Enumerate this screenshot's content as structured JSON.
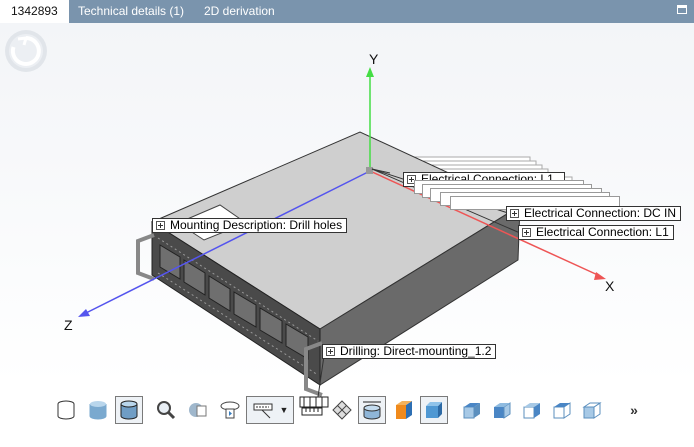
{
  "tabs": [
    {
      "label": "1342893",
      "active": true
    },
    {
      "label": "Technical details (1)",
      "active": false
    },
    {
      "label": "2D derivation",
      "active": false
    }
  ],
  "axes": {
    "x": "X",
    "y": "Y",
    "z": "Z"
  },
  "labels": {
    "mounting": "Mounting Description: Drill holes",
    "elec_dc": "Electrical Connection: DC IN",
    "elec_l1": "Electrical Connection: L1",
    "elec_stack": "Electrical Connection: L1",
    "drilling": "Drilling: Direct-mounting_1.2"
  },
  "toolbar": {
    "more": "»"
  },
  "colors": {
    "tabbar": "#7a94ad",
    "axis_x": "#ee5555",
    "axis_y": "#44dd44",
    "axis_z": "#5555ee",
    "box_top": "#cfcfcf",
    "box_front": "#555555"
  },
  "icons": [
    "sync-logo-icon",
    "cylinder-wire-icon",
    "cylinder-shaded-icon",
    "cylinder-solid-icon",
    "zoom-icon",
    "section-icon",
    "rotate-icon",
    "label-dropdown-icon",
    "measure-icon",
    "mesh-icon",
    "dimension-icon",
    "color-cube-icon",
    "view-front-icon",
    "view-iso-1-icon",
    "view-iso-2-icon",
    "view-iso-3-icon",
    "view-iso-4-icon",
    "view-iso-5-icon"
  ]
}
